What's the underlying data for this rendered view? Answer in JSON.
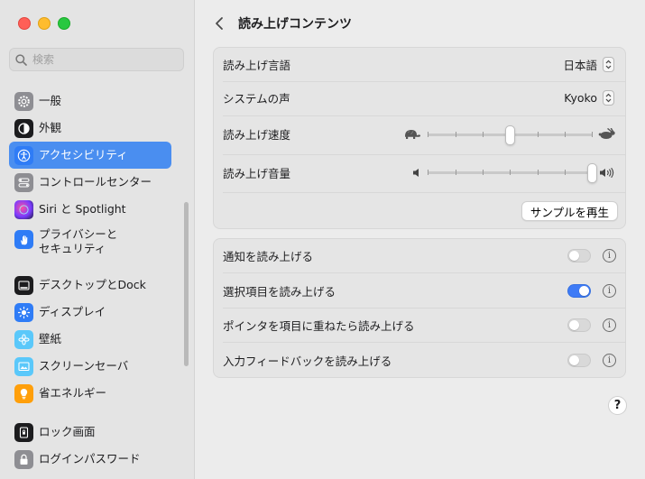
{
  "search": {
    "placeholder": "検索"
  },
  "sidebar": {
    "items": [
      {
        "label": "一般",
        "icon": "gear-icon"
      },
      {
        "label": "外観",
        "icon": "appearance-icon"
      },
      {
        "label": "アクセシビリティ",
        "icon": "accessibility-icon"
      },
      {
        "label": "コントロールセンター",
        "icon": "control-center-icon"
      },
      {
        "label": "Siri と Spotlight",
        "icon": "siri-icon"
      },
      {
        "label": "プライバシーと",
        "label2": "セキュリティ",
        "icon": "hand-icon"
      },
      {
        "label": "デスクトップとDock",
        "icon": "dock-icon"
      },
      {
        "label": "ディスプレイ",
        "icon": "display-icon"
      },
      {
        "label": "壁紙",
        "icon": "wallpaper-icon"
      },
      {
        "label": "スクリーンセーバ",
        "icon": "screensaver-icon"
      },
      {
        "label": "省エネルギー",
        "icon": "lightbulb-icon"
      },
      {
        "label": "ロック画面",
        "icon": "lock-screen-icon"
      },
      {
        "label": "ログインパスワード",
        "icon": "lock-icon"
      }
    ],
    "selected": "アクセシビリティ"
  },
  "main": {
    "title": "読み上げコンテンツ",
    "speech": {
      "language_label": "読み上げ言語",
      "language_value": "日本語",
      "voice_label": "システムの声",
      "voice_value": "Kyoko",
      "rate_label": "読み上げ速度",
      "rate_value": 0.5,
      "volume_label": "読み上げ音量",
      "volume_value": 1.0,
      "play_sample": "サンプルを再生"
    },
    "toggles": [
      {
        "label": "通知を読み上げる",
        "on": false
      },
      {
        "label": "選択項目を読み上げる",
        "on": true
      },
      {
        "label": "ポインタを項目に重ねたら読み上げる",
        "on": false
      },
      {
        "label": "入力フィードバックを読み上げる",
        "on": false
      }
    ],
    "info_glyph": "i",
    "help_glyph": "?"
  },
  "colors": {
    "accent": "#4a8ef0",
    "toggle_on": "#3e7bf6"
  }
}
